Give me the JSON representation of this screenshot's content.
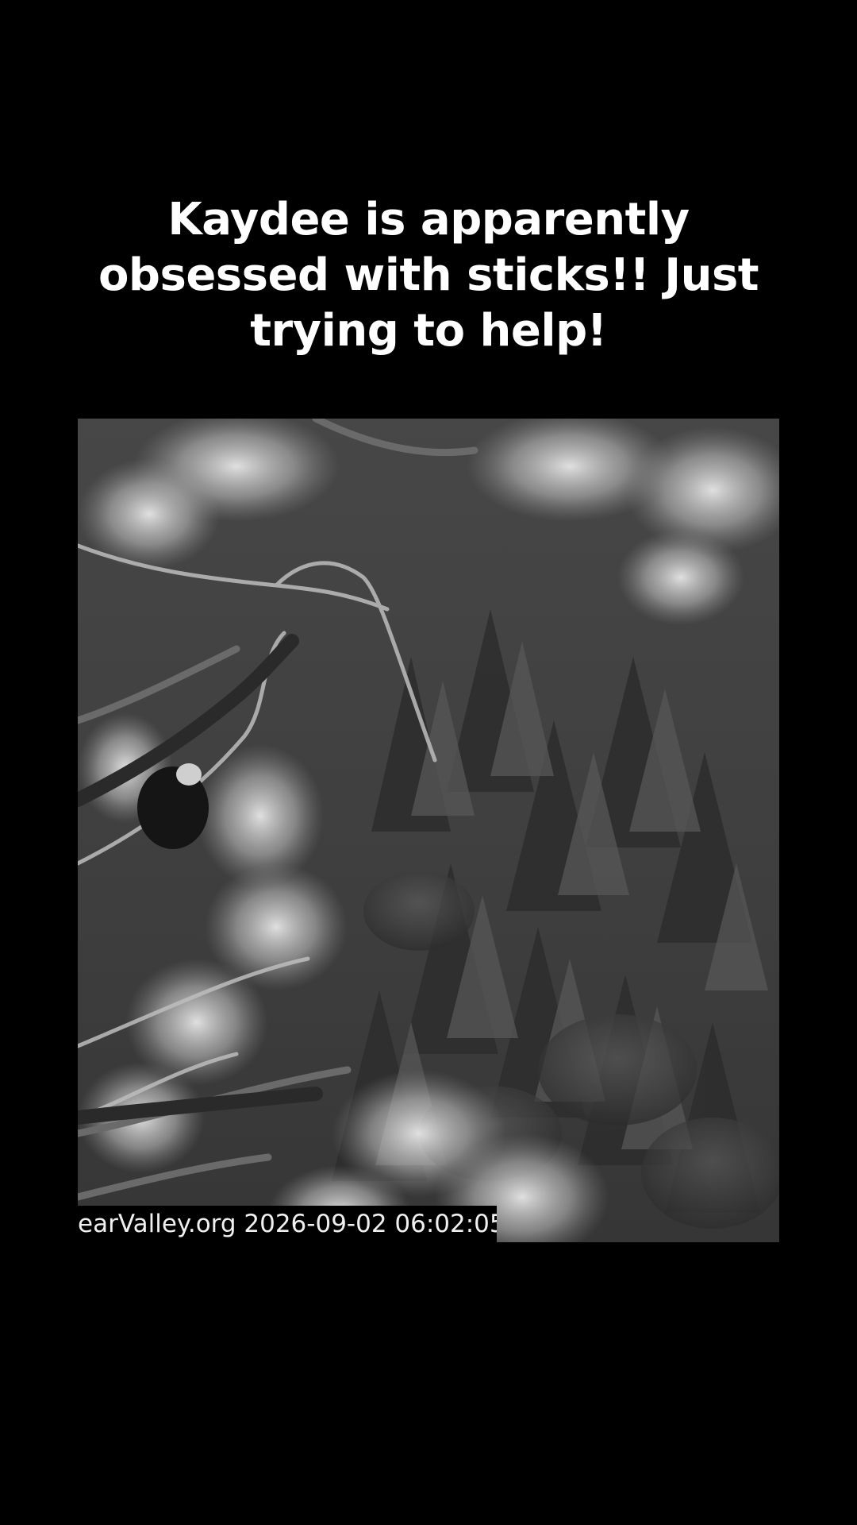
{
  "caption": {
    "text": "Kaydee is apparently obsessed with sticks!! Just trying to help!"
  },
  "video": {
    "overlay_timestamp": "earValley.org 2026-09-02 06:02:05",
    "scene": "grayscale nest camera view of pine branches over forested slope",
    "colors": {
      "background": "#000000",
      "caption_text": "#ffffff"
    }
  }
}
